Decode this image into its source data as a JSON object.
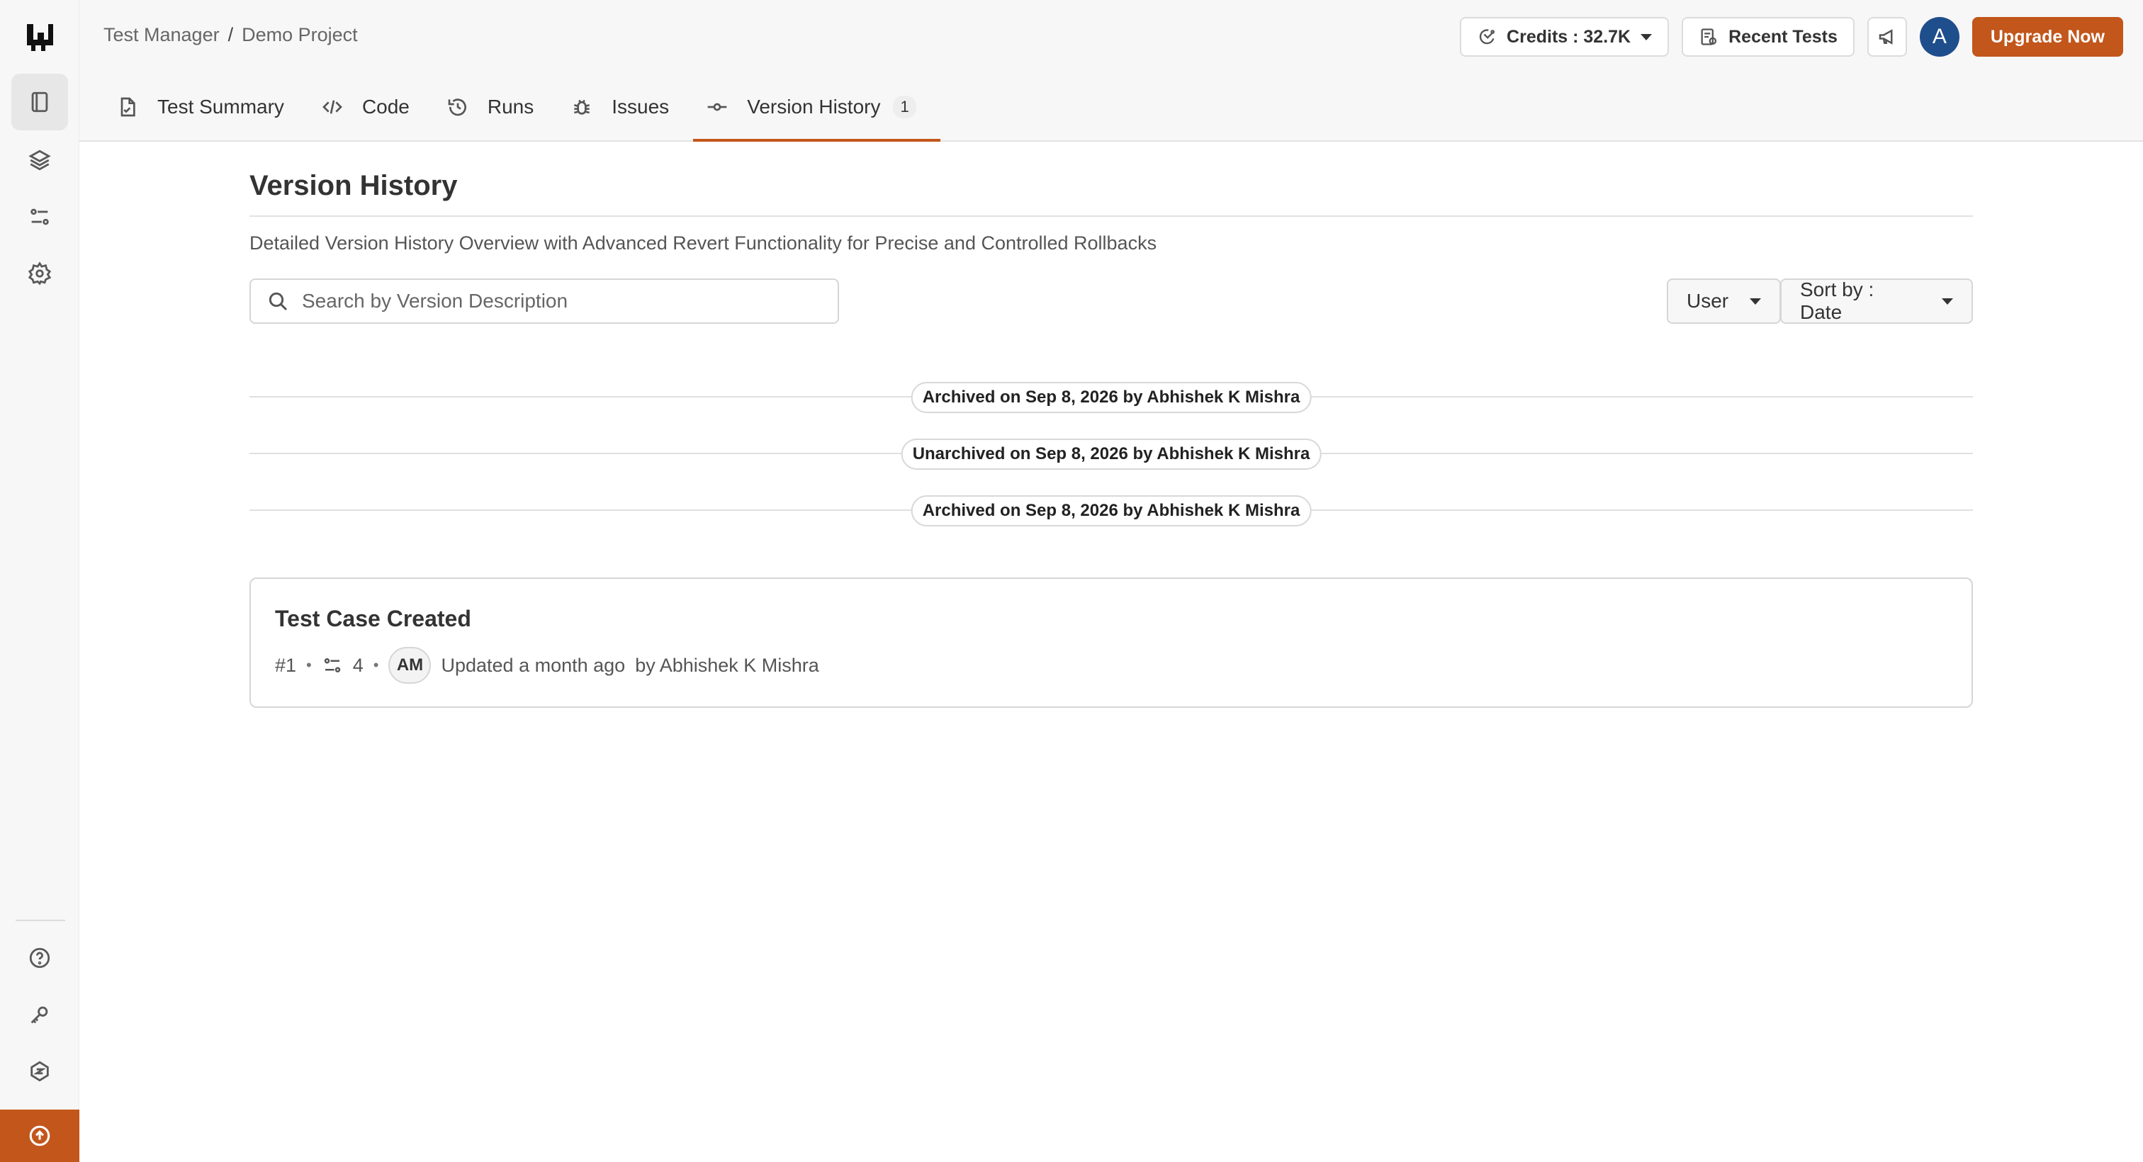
{
  "breadcrumb": {
    "parent": "Test Manager",
    "separator": "/",
    "current": "Demo Project"
  },
  "header": {
    "credits_label": "Credits : 32.7K",
    "recent_tests_label": "Recent Tests",
    "avatar_initial": "A",
    "upgrade_label": "Upgrade Now"
  },
  "tabs": [
    {
      "label": "Test Summary",
      "icon": "file-check-icon"
    },
    {
      "label": "Code",
      "icon": "code-icon"
    },
    {
      "label": "Runs",
      "icon": "history-icon"
    },
    {
      "label": "Issues",
      "icon": "bug-icon"
    },
    {
      "label": "Version History",
      "icon": "commit-icon",
      "badge": "1",
      "active": true
    }
  ],
  "sidebar": {
    "items": [
      "book-icon",
      "layers-icon",
      "workflow-icon",
      "settings-icon"
    ],
    "bottom_items": [
      "help-icon",
      "key-icon",
      "integrations-icon",
      "upgrade-icon"
    ]
  },
  "page": {
    "title": "Version History",
    "description": "Detailed Version History Overview with Advanced Revert Functionality for Precise and Controlled Rollbacks"
  },
  "controls": {
    "search_placeholder": "Search by Version Description",
    "user_filter": "User",
    "sort_label": "Sort by : Date"
  },
  "events": [
    "Archived on Sep 8, 2026 by Abhishek K Mishra",
    "Unarchived on Sep 8, 2026 by Abhishek K Mishra",
    "Archived on Sep 8, 2026 by Abhishek K Mishra"
  ],
  "version": {
    "title": "Test Case Created",
    "number": "#1",
    "step_count": "4",
    "initials": "AM",
    "updated": "Updated a month ago",
    "author": "by Abhishek K Mishra"
  },
  "colors": {
    "accent": "#c2561b",
    "avatar": "#1f4e8c"
  }
}
